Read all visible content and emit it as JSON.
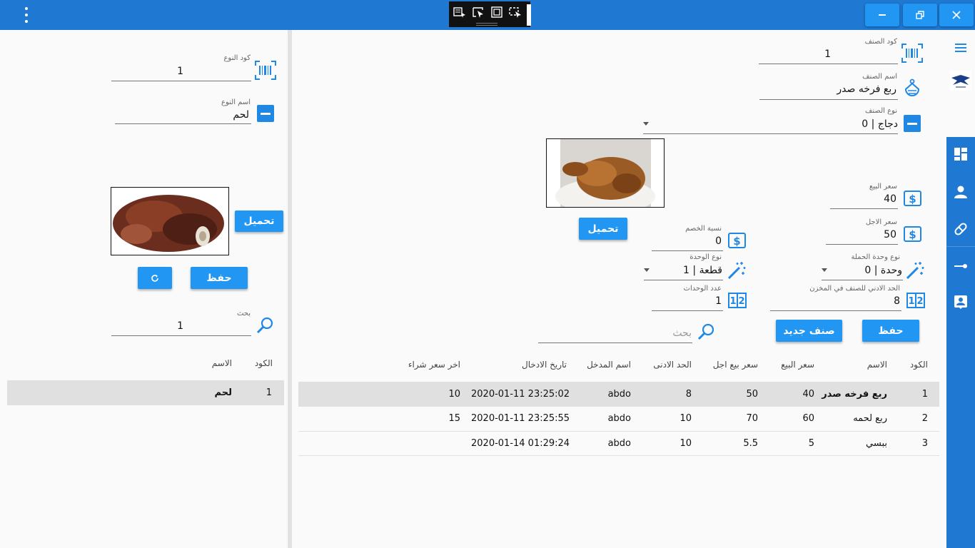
{
  "colors": {
    "accent": "#2196f3",
    "titlebar": "#1f78d1",
    "row_selected": "#e0e0e0"
  },
  "left": {
    "type_code_label": "كود النوع",
    "type_code_value": "1",
    "type_name_label": "اسم النوع",
    "type_name_value": "لحم",
    "upload_label": "تحميل",
    "save_label": "حفظ",
    "search_label": "بحث",
    "search_value": "1",
    "table": {
      "headers": [
        "الكود",
        "الاسم"
      ],
      "rows": [
        {
          "code": "1",
          "name": "لحم"
        }
      ]
    }
  },
  "main": {
    "item_code_label": "كود الصنف",
    "item_code_value": "1",
    "item_name_label": "اسم الصنف",
    "item_name_value": "ربع فرخه صدر",
    "item_type_label": "نوع الصنف",
    "item_type_value": "0 | دجاج",
    "sale_price_label": "سعر البيع",
    "sale_price_value": "40",
    "credit_price_label": "سعر الاجل",
    "credit_price_value": "50",
    "discount_label": "نسبة الخصم",
    "discount_value": "0",
    "unit_type_label": "نوع الوحدة",
    "unit_type_value": "1 | قطعة",
    "bulk_unit_label": "نوع وحدة الحملة",
    "bulk_unit_value": "0 | وحدة",
    "unit_count_label": "عدد الوحدات",
    "unit_count_value": "1",
    "min_stock_label": "الحد الادني للصنف  في المخزن",
    "min_stock_value": "8",
    "upload_label": "تحميل",
    "save_label": "حفظ",
    "new_item_label": "صنف جديد",
    "search_placeholder": "بحث",
    "table": {
      "headers": [
        "الكود",
        "الاسم",
        "سعر البيع",
        "سعر بيع اجل",
        "الحد الادنى",
        "اسم المدخل",
        "تاريخ الادخال",
        "اخر سعر شراء"
      ],
      "rows": [
        {
          "code": "1",
          "name": "ربع فرخه صدر",
          "sale": "40",
          "credit": "50",
          "min": "8",
          "user": "abdo",
          "date": "2020-01-11 23:25:02",
          "last": "10"
        },
        {
          "code": "2",
          "name": "ربع لحمه",
          "sale": "60",
          "credit": "70",
          "min": "10",
          "user": "abdo",
          "date": "2020-01-11 23:25:55",
          "last": "15"
        },
        {
          "code": "3",
          "name": "ببسي",
          "sale": "5",
          "credit": "5.5",
          "min": "10",
          "user": "abdo",
          "date": "2020-01-14 01:29:24",
          "last": ""
        }
      ]
    }
  },
  "icons": {
    "minimize": "minimize-icon",
    "restore": "restore-icon",
    "close": "close-icon",
    "barcode": "barcode-icon",
    "tag": "tag-icon",
    "dollar": "dollar-icon",
    "wand": "magic-wand-icon",
    "numbers": "numbers-icon",
    "search": "search-icon"
  }
}
